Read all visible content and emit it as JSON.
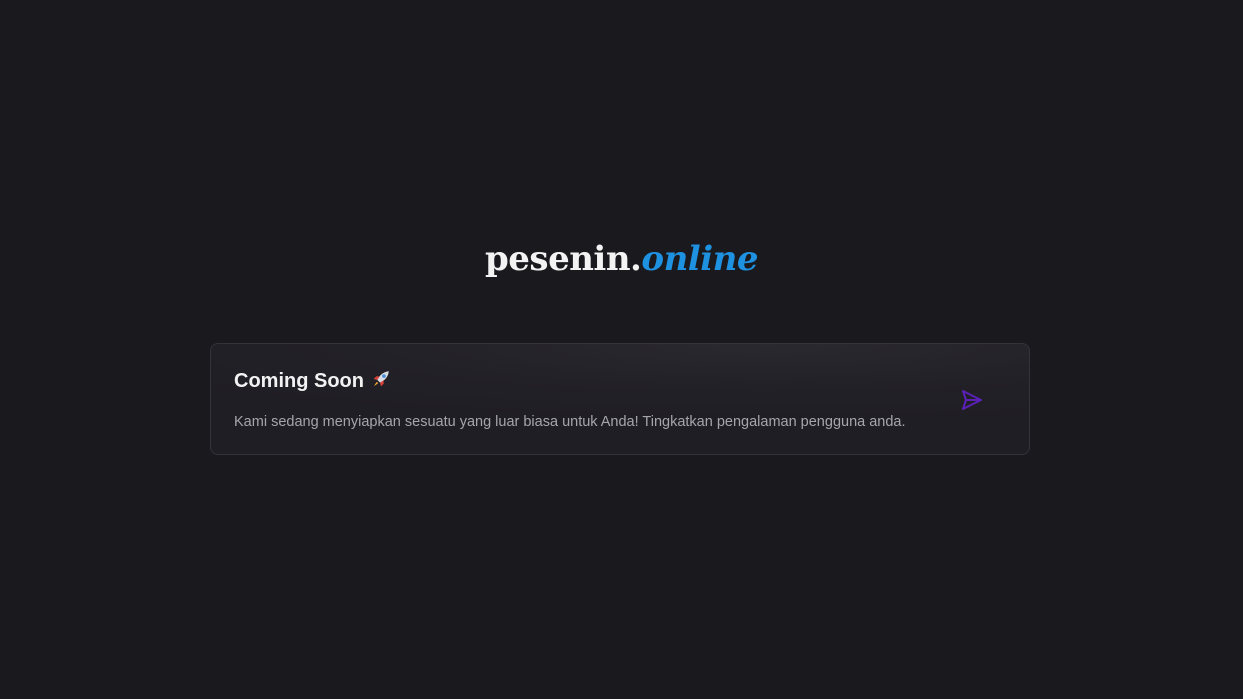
{
  "brand": {
    "name": "pesenin.",
    "tld": "online",
    "accent_color": "#1e91e0"
  },
  "card": {
    "title": "Coming Soon",
    "title_icon": "rocket-icon",
    "message": "Kami sedang menyiapkan sesuatu yang luar biasa untuk Anda! Tingkatkan pengalaman pengguna anda.",
    "action_icon": "send-icon",
    "action_color": "#5b21b6"
  }
}
